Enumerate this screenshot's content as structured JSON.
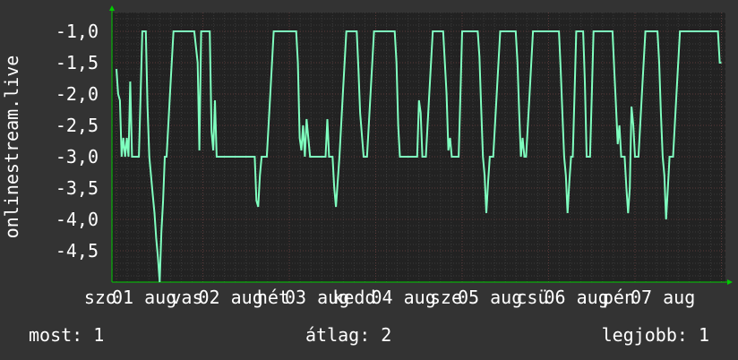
{
  "colors": {
    "background": "#333333",
    "plot_background": "#222222",
    "line": "#7fffbf",
    "grid_major": "#5a3a3a",
    "grid_minor": "#3a3a3a",
    "axis_arrow": "#00cc00",
    "text": "#ffffff"
  },
  "footer": {
    "now_label": "most:",
    "now_value": "1",
    "avg_label": "átlag:",
    "avg_value": "2",
    "max_label": "legjobb:",
    "max_value": "1"
  },
  "chart_data": {
    "type": "line",
    "ylabel": "onlinestream.live",
    "ylim": [
      -5.0,
      -0.7
    ],
    "xlim": [
      0,
      7
    ],
    "y_ticks": [
      -1.0,
      -1.5,
      -2.0,
      -2.5,
      -3.0,
      -3.5,
      -4.0,
      -4.5
    ],
    "y_tick_labels": [
      "-1,0",
      "-1,5",
      "-2,0",
      "-2,5",
      "-3,0",
      "-3,5",
      "-4,0",
      "-4,5"
    ],
    "x_tick_labels": [
      {
        "pos": 0.0,
        "day": "szo",
        "date": "01 aug"
      },
      {
        "pos": 1.0,
        "day": "vas",
        "date": "02 aug"
      },
      {
        "pos": 2.0,
        "day": "hét",
        "date": "03 aug"
      },
      {
        "pos": 3.0,
        "day": "kedd",
        "date": "04 aug"
      },
      {
        "pos": 4.0,
        "day": "sze",
        "date": "05 aug"
      },
      {
        "pos": 5.0,
        "day": "csü",
        "date": "06 aug"
      },
      {
        "pos": 6.0,
        "day": "pén",
        "date": "07 aug"
      }
    ],
    "grid": true,
    "legend": "none",
    "series": [
      {
        "points": [
          [
            0.0,
            -1.6
          ],
          [
            0.02,
            -2.0
          ],
          [
            0.04,
            -2.1
          ],
          [
            0.06,
            -3.0
          ],
          [
            0.08,
            -2.7
          ],
          [
            0.1,
            -3.0
          ],
          [
            0.12,
            -2.7
          ],
          [
            0.14,
            -3.0
          ],
          [
            0.16,
            -1.8
          ],
          [
            0.18,
            -3.0
          ],
          [
            0.22,
            -3.0
          ],
          [
            0.26,
            -3.0
          ],
          [
            0.3,
            -1.0
          ],
          [
            0.34,
            -1.0
          ],
          [
            0.36,
            -2.2
          ],
          [
            0.38,
            -3.0
          ],
          [
            0.4,
            -3.3
          ],
          [
            0.42,
            -3.6
          ],
          [
            0.44,
            -3.9
          ],
          [
            0.46,
            -4.3
          ],
          [
            0.48,
            -4.6
          ],
          [
            0.5,
            -5.0
          ],
          [
            0.52,
            -4.2
          ],
          [
            0.54,
            -3.7
          ],
          [
            0.56,
            -3.0
          ],
          [
            0.58,
            -3.0
          ],
          [
            0.62,
            -2.0
          ],
          [
            0.66,
            -1.0
          ],
          [
            0.9,
            -1.0
          ],
          [
            0.94,
            -1.5
          ],
          [
            0.96,
            -2.9
          ],
          [
            0.98,
            -1.0
          ],
          [
            1.08,
            -1.0
          ],
          [
            1.1,
            -2.6
          ],
          [
            1.12,
            -2.9
          ],
          [
            1.14,
            -2.1
          ],
          [
            1.16,
            -3.0
          ],
          [
            1.6,
            -3.0
          ],
          [
            1.62,
            -3.7
          ],
          [
            1.64,
            -3.8
          ],
          [
            1.66,
            -3.3
          ],
          [
            1.68,
            -3.0
          ],
          [
            1.74,
            -3.0
          ],
          [
            1.78,
            -2.0
          ],
          [
            1.82,
            -1.0
          ],
          [
            2.08,
            -1.0
          ],
          [
            2.1,
            -1.5
          ],
          [
            2.12,
            -2.7
          ],
          [
            2.14,
            -2.9
          ],
          [
            2.16,
            -2.5
          ],
          [
            2.18,
            -3.0
          ],
          [
            2.2,
            -2.4
          ],
          [
            2.24,
            -3.0
          ],
          [
            2.42,
            -3.0
          ],
          [
            2.44,
            -2.4
          ],
          [
            2.46,
            -3.0
          ],
          [
            2.5,
            -3.0
          ],
          [
            2.52,
            -3.5
          ],
          [
            2.54,
            -3.8
          ],
          [
            2.58,
            -3.0
          ],
          [
            2.62,
            -2.0
          ],
          [
            2.66,
            -1.0
          ],
          [
            2.78,
            -1.0
          ],
          [
            2.8,
            -1.6
          ],
          [
            2.82,
            -2.3
          ],
          [
            2.86,
            -3.0
          ],
          [
            2.9,
            -3.0
          ],
          [
            2.94,
            -2.0
          ],
          [
            2.98,
            -1.0
          ],
          [
            3.22,
            -1.0
          ],
          [
            3.24,
            -1.5
          ],
          [
            3.26,
            -2.5
          ],
          [
            3.28,
            -3.0
          ],
          [
            3.48,
            -3.0
          ],
          [
            3.5,
            -2.1
          ],
          [
            3.52,
            -2.3
          ],
          [
            3.54,
            -3.0
          ],
          [
            3.58,
            -3.0
          ],
          [
            3.62,
            -2.0
          ],
          [
            3.66,
            -1.0
          ],
          [
            3.78,
            -1.0
          ],
          [
            3.8,
            -1.5
          ],
          [
            3.82,
            -2.0
          ],
          [
            3.84,
            -2.9
          ],
          [
            3.86,
            -2.7
          ],
          [
            3.88,
            -3.0
          ],
          [
            3.96,
            -3.0
          ],
          [
            3.98,
            -2.0
          ],
          [
            4.0,
            -1.0
          ],
          [
            4.18,
            -1.0
          ],
          [
            4.2,
            -1.4
          ],
          [
            4.22,
            -2.2
          ],
          [
            4.24,
            -3.0
          ],
          [
            4.26,
            -3.3
          ],
          [
            4.28,
            -3.9
          ],
          [
            4.3,
            -3.4
          ],
          [
            4.32,
            -3.0
          ],
          [
            4.36,
            -3.0
          ],
          [
            4.4,
            -2.0
          ],
          [
            4.44,
            -1.0
          ],
          [
            4.62,
            -1.0
          ],
          [
            4.64,
            -1.5
          ],
          [
            4.66,
            -2.3
          ],
          [
            4.68,
            -3.0
          ],
          [
            4.7,
            -2.7
          ],
          [
            4.72,
            -3.0
          ],
          [
            4.74,
            -3.0
          ],
          [
            4.78,
            -2.0
          ],
          [
            4.82,
            -1.0
          ],
          [
            5.12,
            -1.0
          ],
          [
            5.14,
            -1.6
          ],
          [
            5.16,
            -2.3
          ],
          [
            5.18,
            -3.0
          ],
          [
            5.2,
            -3.3
          ],
          [
            5.22,
            -3.9
          ],
          [
            5.24,
            -3.4
          ],
          [
            5.26,
            -3.0
          ],
          [
            5.28,
            -3.0
          ],
          [
            5.3,
            -2.0
          ],
          [
            5.32,
            -1.0
          ],
          [
            5.4,
            -1.0
          ],
          [
            5.42,
            -1.8
          ],
          [
            5.44,
            -3.0
          ],
          [
            5.48,
            -3.0
          ],
          [
            5.5,
            -2.0
          ],
          [
            5.52,
            -1.0
          ],
          [
            5.74,
            -1.0
          ],
          [
            5.76,
            -1.6
          ],
          [
            5.78,
            -2.2
          ],
          [
            5.8,
            -2.8
          ],
          [
            5.82,
            -2.5
          ],
          [
            5.84,
            -3.0
          ],
          [
            5.88,
            -3.0
          ],
          [
            5.9,
            -3.5
          ],
          [
            5.92,
            -3.9
          ],
          [
            5.94,
            -3.5
          ],
          [
            5.96,
            -2.2
          ],
          [
            5.98,
            -2.5
          ],
          [
            6.0,
            -3.0
          ],
          [
            6.04,
            -3.0
          ],
          [
            6.08,
            -2.0
          ],
          [
            6.12,
            -1.0
          ],
          [
            6.26,
            -1.0
          ],
          [
            6.28,
            -1.5
          ],
          [
            6.3,
            -2.3
          ],
          [
            6.32,
            -3.0
          ],
          [
            6.34,
            -3.3
          ],
          [
            6.36,
            -4.0
          ],
          [
            6.38,
            -3.5
          ],
          [
            6.4,
            -3.0
          ],
          [
            6.44,
            -3.0
          ],
          [
            6.48,
            -2.0
          ],
          [
            6.52,
            -1.0
          ],
          [
            6.96,
            -1.0
          ],
          [
            6.98,
            -1.5
          ],
          [
            7.0,
            -1.5
          ]
        ]
      }
    ]
  }
}
